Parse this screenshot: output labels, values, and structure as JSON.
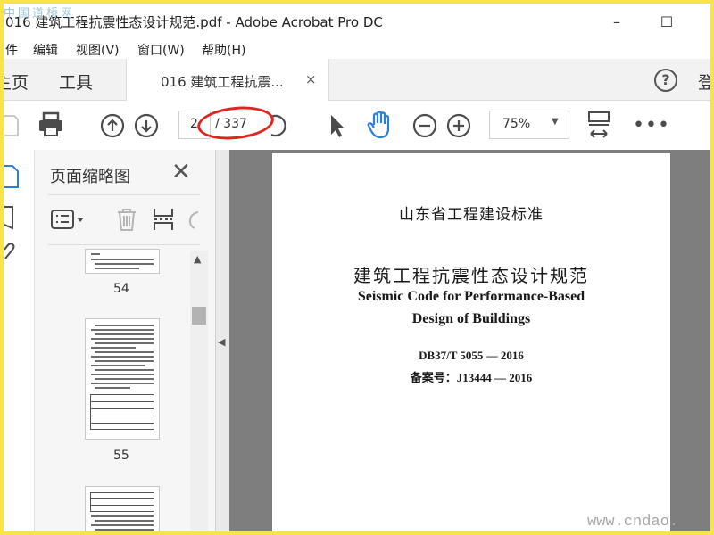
{
  "window": {
    "title": "016 建筑工程抗震性态设计规范.pdf - Adobe Acrobat Pro DC",
    "watermark_top": "中国道桥网",
    "minimize_glyph": "–",
    "maximize_glyph": "☐"
  },
  "menu": [
    "件",
    "编辑",
    "视图(V)",
    "窗口(W)",
    "帮助(H)"
  ],
  "nav": {
    "home": "主页",
    "tools": "工具",
    "doc_tab": "016 建筑工程抗震...",
    "doc_tab_close": "×",
    "help": "?",
    "signin": "登"
  },
  "toolbar": {
    "current_page": "2",
    "total_pages": "/ 337",
    "zoom": "75%",
    "icons": [
      "print-icon",
      "page-up-icon",
      "page-down-icon",
      "select-arrow-icon",
      "hand-tool-icon",
      "zoom-out-icon",
      "zoom-in-icon",
      "fit-page-icon",
      "more-icon"
    ]
  },
  "panel": {
    "title": "页面缩略图",
    "close": "✕",
    "thumbnails": [
      {
        "page": "54"
      },
      {
        "page": "55"
      }
    ]
  },
  "document": {
    "standard": "山东省工程建设标准",
    "title_cn": "建筑工程抗震性态设计规范",
    "title_en_line1": "Seismic Code for Performance-Based",
    "title_en_line2": "Design of Buildings",
    "code": "DB37/T 5055 — 2016",
    "record_no": "备案号：J13444 — 2016"
  },
  "watermark_bottom": "www.cndao.",
  "colors": {
    "annotation": "#e0241f",
    "hand_tool": "#2b7fd6",
    "frame_border": "#f6e44a",
    "doc_background": "#7e7e7e"
  }
}
